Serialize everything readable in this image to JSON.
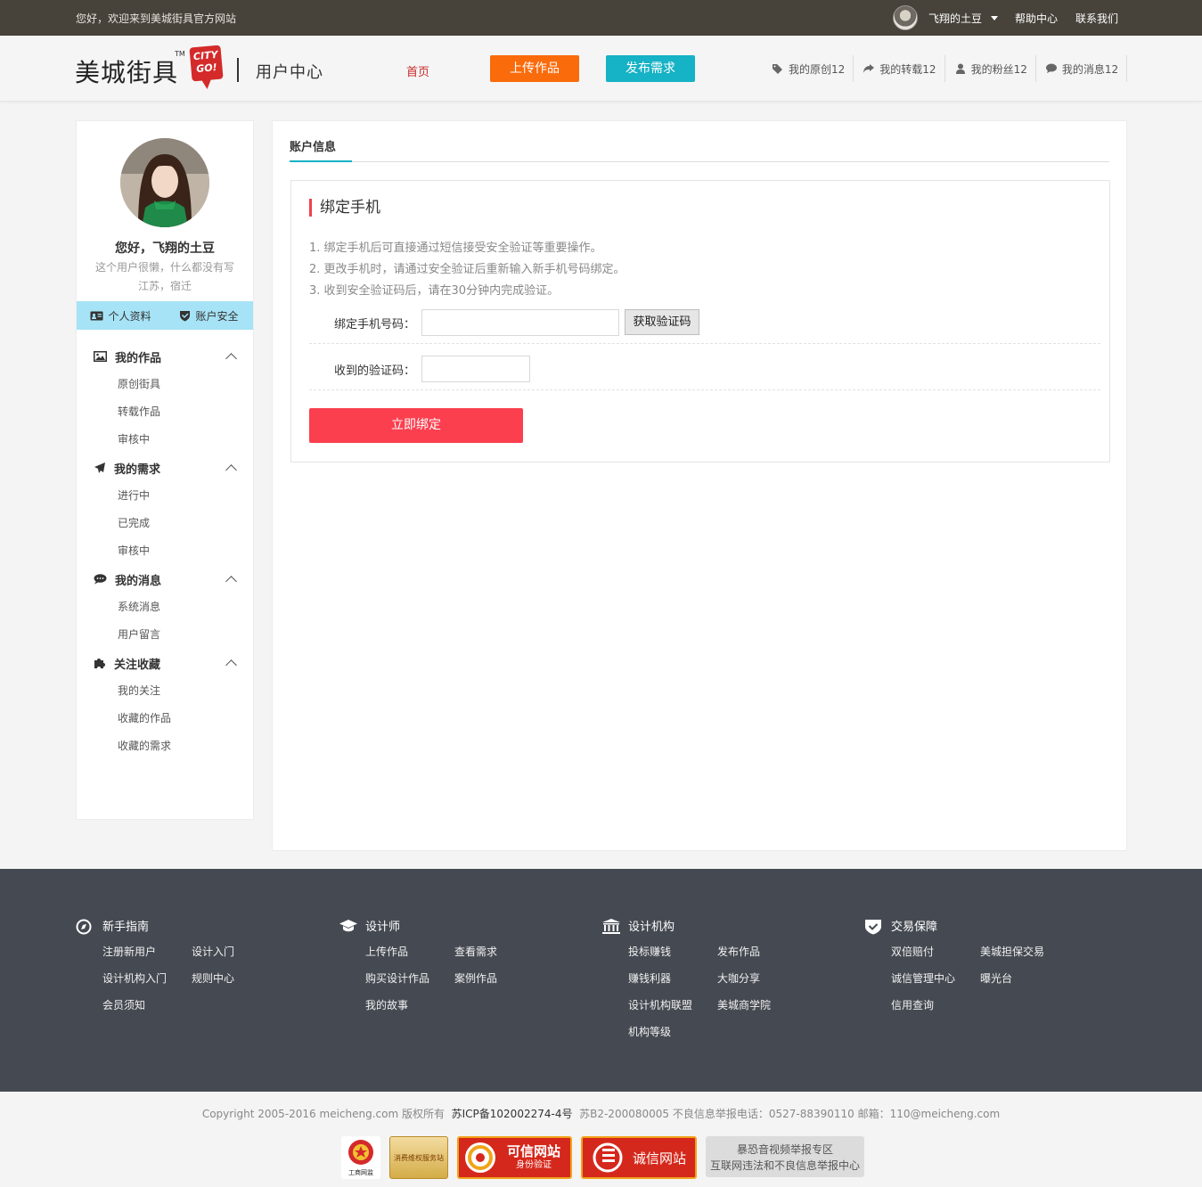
{
  "topbar": {
    "welcome": "您好，欢迎来到美城街具官方网站",
    "username": "飞翔的土豆",
    "help": "帮助中心",
    "contact": "联系我们"
  },
  "header": {
    "logo_text": "美城街具",
    "logo_tm": "TM",
    "logo_badge_line1": "CITY",
    "logo_badge_line2": "GO!",
    "logo_sub": "用户中心",
    "nav_home": "首页",
    "upload_button": "上传作品",
    "publish_button": "发布需求",
    "stats": [
      {
        "icon": "tags-icon",
        "label": "我的原创12"
      },
      {
        "icon": "share-icon",
        "label": "我的转载12"
      },
      {
        "icon": "user-icon",
        "label": "我的粉丝12"
      },
      {
        "icon": "comment-icon",
        "label": "我的消息12"
      }
    ]
  },
  "sidebar": {
    "hello": "您好，飞翔的土豆",
    "motto": "这个用户很懒，什么都没有写",
    "location": "江苏，宿迁",
    "tab_profile": "个人资料",
    "tab_security": "账户安全",
    "groups": [
      {
        "icon": "image-icon",
        "title": "我的作品",
        "items": [
          "原创街具",
          "转载作品",
          "审核中"
        ]
      },
      {
        "icon": "send-icon",
        "title": "我的需求",
        "items": [
          "进行中",
          "已完成",
          "审核中"
        ]
      },
      {
        "icon": "chat-icon",
        "title": "我的消息",
        "items": [
          "系统消息",
          "用户留言"
        ]
      },
      {
        "icon": "puzzle-icon",
        "title": "关注收藏",
        "items": [
          "我的关注",
          "收藏的作品",
          "收藏的需求"
        ]
      }
    ]
  },
  "main": {
    "tab": "账户信息",
    "box_title": "绑定手机",
    "tips": [
      "1. 绑定手机后可直接通过短信接受安全验证等重要操作。",
      "2. 更改手机时，请通过安全验证后重新输入新手机号码绑定。",
      "3. 收到安全验证码后，请在30分钟内完成验证。"
    ],
    "phone_label": "绑定手机号码：",
    "phone_value": "",
    "get_code_button": "获取验证码",
    "code_label": "收到的验证码：",
    "code_value": "",
    "bind_button": "立即绑定"
  },
  "footer": {
    "cols": [
      {
        "icon": "compass-icon",
        "title": "新手指南",
        "links": [
          "注册新用户",
          "设计入门",
          "设计机构入门",
          "规则中心",
          "会员须知"
        ]
      },
      {
        "icon": "graduation-cap-icon",
        "title": "设计师",
        "links": [
          "上传作品",
          "查看需求",
          "购买设计作品",
          "案例作品",
          "我的故事"
        ]
      },
      {
        "icon": "bank-icon",
        "title": "设计机构",
        "links": [
          "投标赚钱",
          "发布作品",
          "赚钱利器",
          "大咖分享",
          "设计机构联盟",
          "美城商学院",
          "机构等级"
        ]
      },
      {
        "icon": "shield-check-icon",
        "title": "交易保障",
        "links": [
          "双倍赔付",
          "美城担保交易",
          "诚信管理中心",
          "曝光台",
          "信用查询"
        ]
      }
    ],
    "copyright_a": "Copyright 2005-2016 meicheng.com 版权所有",
    "icp": "苏ICP备102002274-4号",
    "copyright_b": "苏B2-200080005 不良信息举报电话：0527-88390110 邮箱：110@meicheng.com",
    "badges": {
      "gongshang": "工商网监",
      "xiaofei": "消费维权服务站",
      "kexin_title": "可信网站",
      "kexin_sub": "身份验证",
      "chengxin": "诚信网站",
      "report_line1": "暴恐音视频举报专区",
      "report_line2": "互联网违法和不良信息举报中心"
    }
  }
}
